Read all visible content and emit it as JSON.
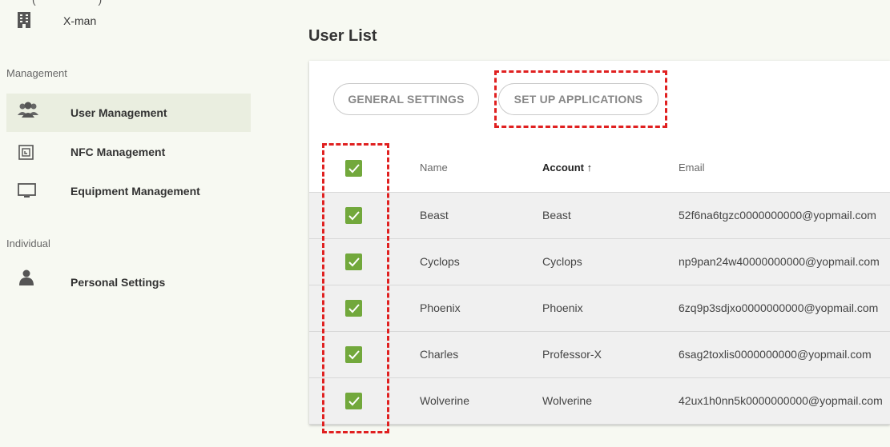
{
  "top_strip": "(                    )",
  "org": {
    "name": "X-man",
    "icon": "building-icon"
  },
  "sidebar": {
    "section_management": "Management",
    "section_individual": "Individual",
    "items": [
      {
        "label": "User Management",
        "icon": "users-icon",
        "active": true
      },
      {
        "label": "NFC Management",
        "icon": "nfc-icon",
        "active": false
      },
      {
        "label": "Equipment Management",
        "icon": "monitor-icon",
        "active": false
      },
      {
        "label": "Personal Settings",
        "icon": "user-icon",
        "active": false
      }
    ]
  },
  "main": {
    "title": "User List",
    "buttons": {
      "general": "GENERAL SETTINGS",
      "setup": "SET UP APPLICATIONS"
    },
    "table": {
      "headers": {
        "name": "Name",
        "account": "Account ↑",
        "email": "Email"
      },
      "rows": [
        {
          "name": "Beast",
          "account": "Beast",
          "email": "52f6na6tgzc0000000000@yopmail.com",
          "checked": true
        },
        {
          "name": "Cyclops",
          "account": "Cyclops",
          "email": "np9pan24w40000000000@yopmail.com",
          "checked": true
        },
        {
          "name": "Phoenix",
          "account": "Phoenix",
          "email": "6zq9p3sdjxo0000000000@yopmail.com",
          "checked": true
        },
        {
          "name": "Charles",
          "account": "Professor-X",
          "email": "6sag2toxlis0000000000@yopmail.com",
          "checked": true
        },
        {
          "name": "Wolverine",
          "account": "Wolverine",
          "email": "42ux1h0nn5k0000000000@yopmail.com",
          "checked": true
        }
      ]
    }
  },
  "colors": {
    "accent_green": "#72a83c",
    "highlight_red": "#e02020",
    "background": "#f7f9f2"
  }
}
